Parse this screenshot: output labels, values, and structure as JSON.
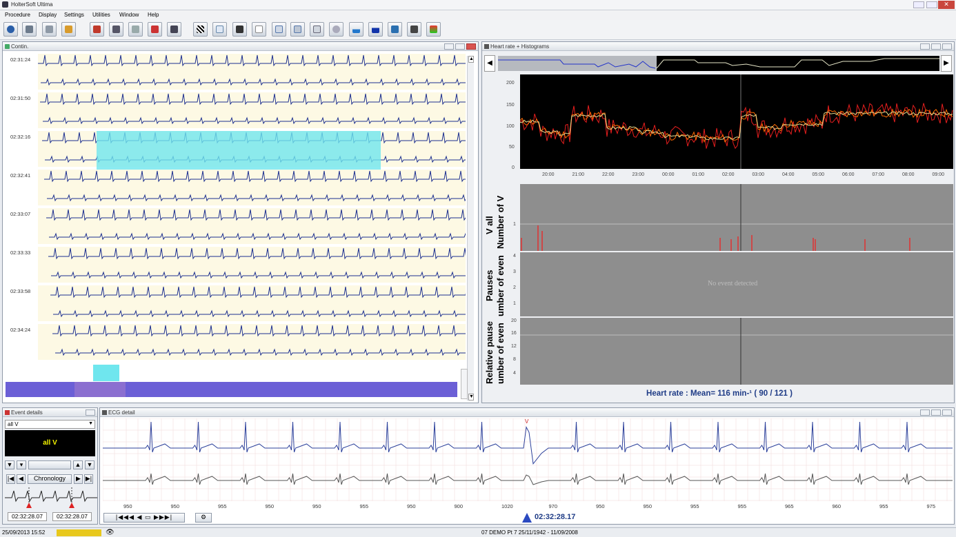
{
  "app": {
    "title": "HolterSoft Ultima"
  },
  "menu": [
    "Procedure",
    "Display",
    "Settings",
    "Utilities",
    "Window",
    "Help"
  ],
  "toolbar_icons": [
    "open-record-icon",
    "disk-icon",
    "network-icon",
    "pen-icon",
    "undo-icon",
    "monitor-icon",
    "eraser-icon",
    "print-icon",
    "save-icon",
    "flag-icon",
    "ecg-grid-icon",
    "report-icon",
    "page-icon",
    "table-icon",
    "calculator-icon",
    "gear-report-icon",
    "histogram-icon",
    "histogram-blue-icon",
    "mosaic-icon",
    "recorder-icon",
    "tape-icon"
  ],
  "left_panel": {
    "title": "Contin.",
    "timestamps": [
      "02:31:24",
      "02:31:50",
      "02:32:16",
      "02:32:41",
      "02:33:07",
      "02:33:33",
      "02:33:58",
      "02:34:24"
    ]
  },
  "right_panel": {
    "title": "Heart rate + Histograms",
    "hr_yticks": [
      "200",
      "150",
      "100",
      "50",
      "0"
    ],
    "hr_xticks": [
      "20:00",
      "21:00",
      "22:00",
      "23:00",
      "00:00",
      "01:00",
      "02:00",
      "03:00",
      "04:00",
      "05:00",
      "06:00",
      "07:00",
      "08:00",
      "09:00"
    ],
    "panel_v": {
      "title": "V all",
      "ylabel": "Number of V",
      "yticks": [
        "1"
      ]
    },
    "panel_pauses": {
      "title": "Pauses",
      "ylabel": "umber of even",
      "yticks": [
        "4",
        "3",
        "2",
        "1"
      ],
      "message": "No event detected"
    },
    "panel_rel": {
      "title": "Relative pause",
      "ylabel": "umber of even",
      "yticks": [
        "20",
        "16",
        "12",
        "8",
        "4"
      ]
    },
    "footer": "Heart rate : Mean= 116 min-¹  ( 90 / 121 )"
  },
  "event_details": {
    "title": "Event details",
    "select_value": "all V",
    "display": "all V",
    "sort_label": "Chronology",
    "time1": "02:32:28.07",
    "time2": "02:32:28.07"
  },
  "ecg_detail": {
    "title": "ECG detail",
    "beat_marker": "V",
    "rr_labels": [
      "950",
      "950",
      "955",
      "950",
      "950",
      "955",
      "950",
      "900",
      "1020",
      "970",
      "950",
      "950",
      "955",
      "955",
      "965",
      "960",
      "955",
      "975"
    ],
    "cursor_time": "02:32:28.17"
  },
  "status": {
    "datetime": "25/09/2013 15:52",
    "patient": "07 DEMO Pt 7 25/11/1942 - 11/09/2008"
  },
  "colors": {
    "ecg_trace": "#1c2f8f",
    "highlight": "#6fe6ee",
    "overview_bar": "#6b5fd6",
    "hr_primary": "#e81e1e",
    "hr_secondary": "#e8d98a"
  }
}
